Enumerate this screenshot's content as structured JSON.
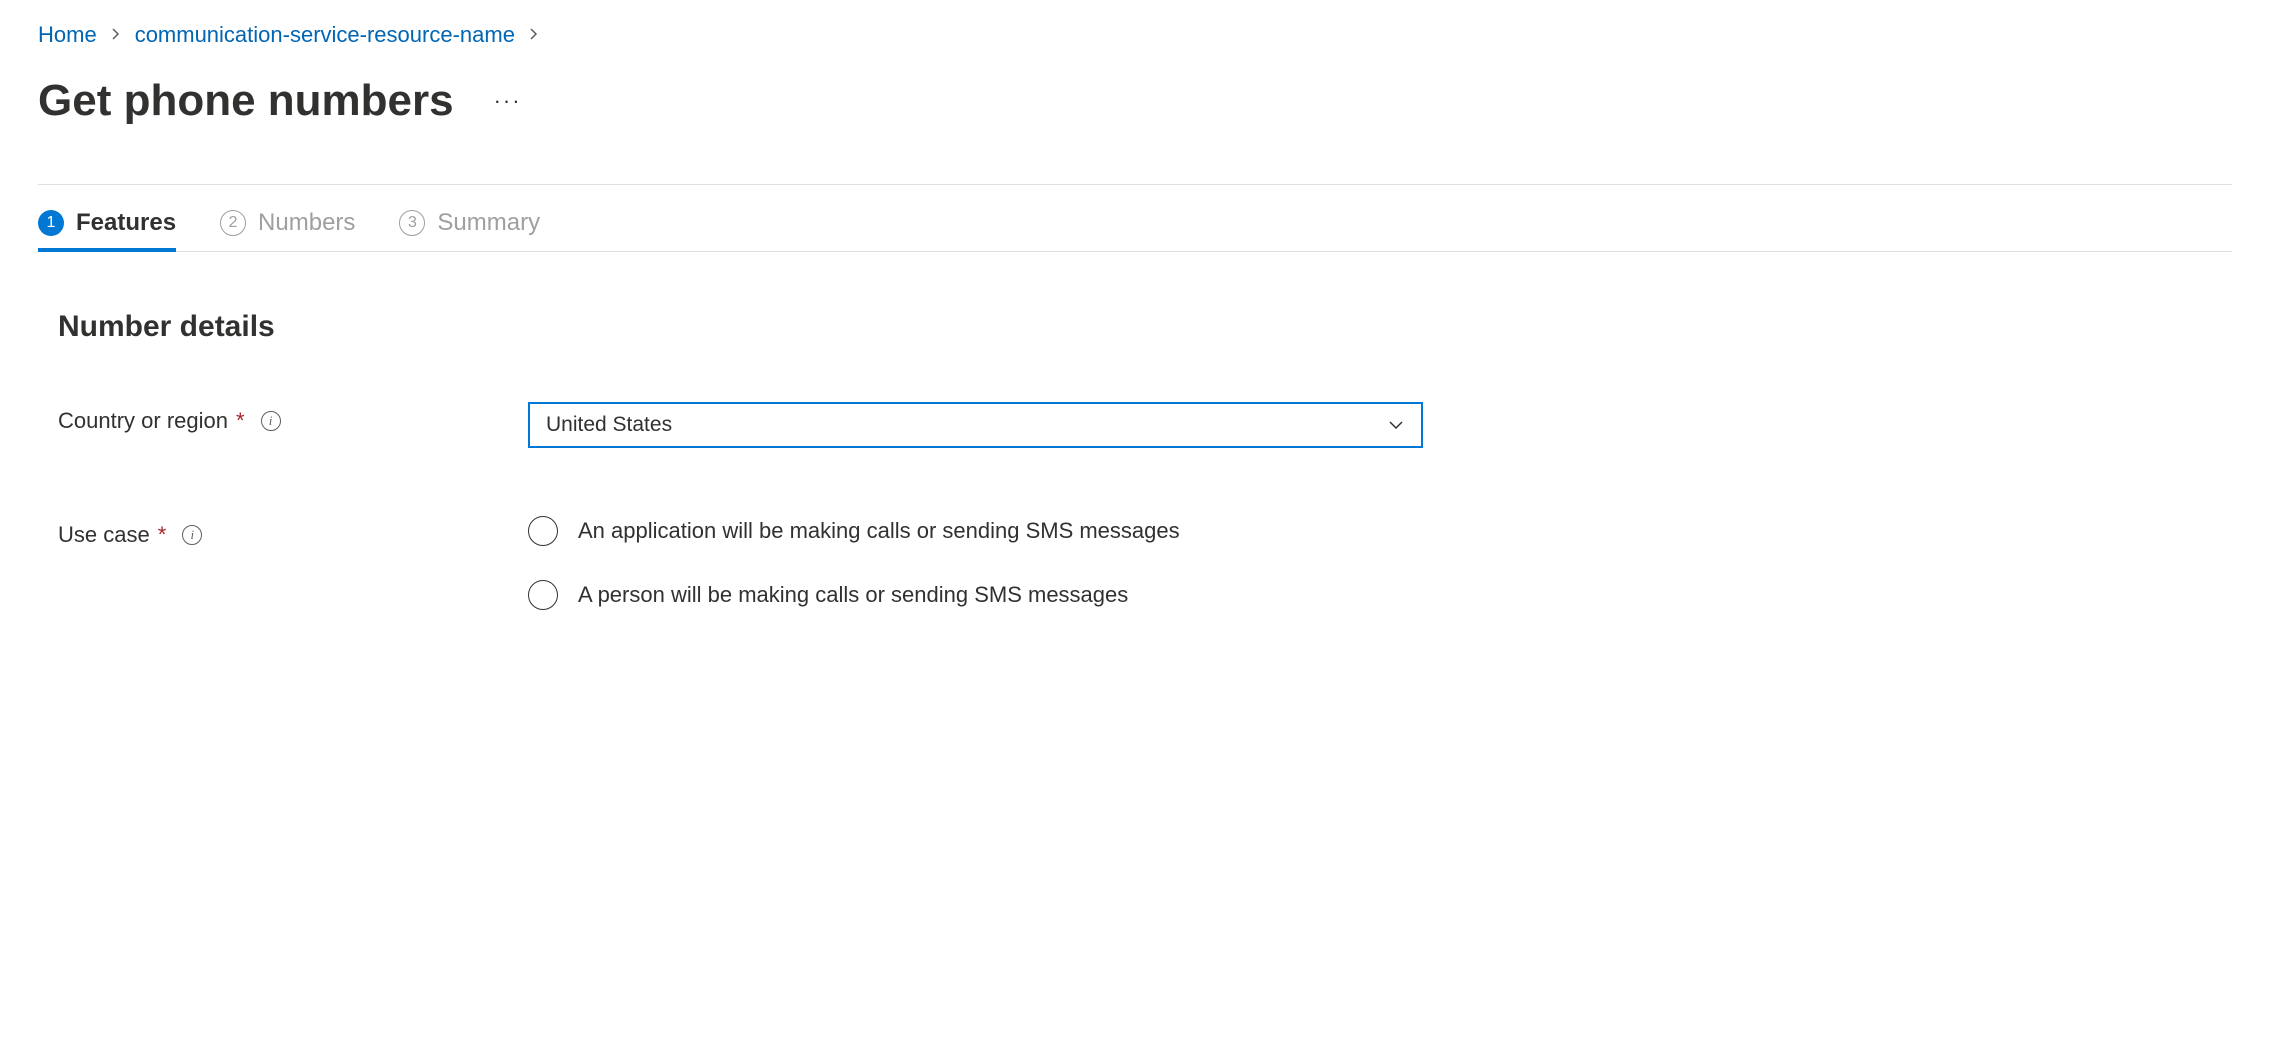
{
  "breadcrumb": {
    "home": "Home",
    "resource": "communication-service-resource-name"
  },
  "page": {
    "title": "Get phone numbers"
  },
  "tabs": [
    {
      "num": "1",
      "label": "Features",
      "active": true
    },
    {
      "num": "2",
      "label": "Numbers",
      "active": false
    },
    {
      "num": "3",
      "label": "Summary",
      "active": false
    }
  ],
  "section": {
    "title": "Number details"
  },
  "form": {
    "country": {
      "label": "Country or region",
      "value": "United States"
    },
    "usecase": {
      "label": "Use case",
      "options": [
        "An application will be making calls or sending SMS messages",
        "A person will be making calls or sending SMS messages"
      ]
    }
  }
}
